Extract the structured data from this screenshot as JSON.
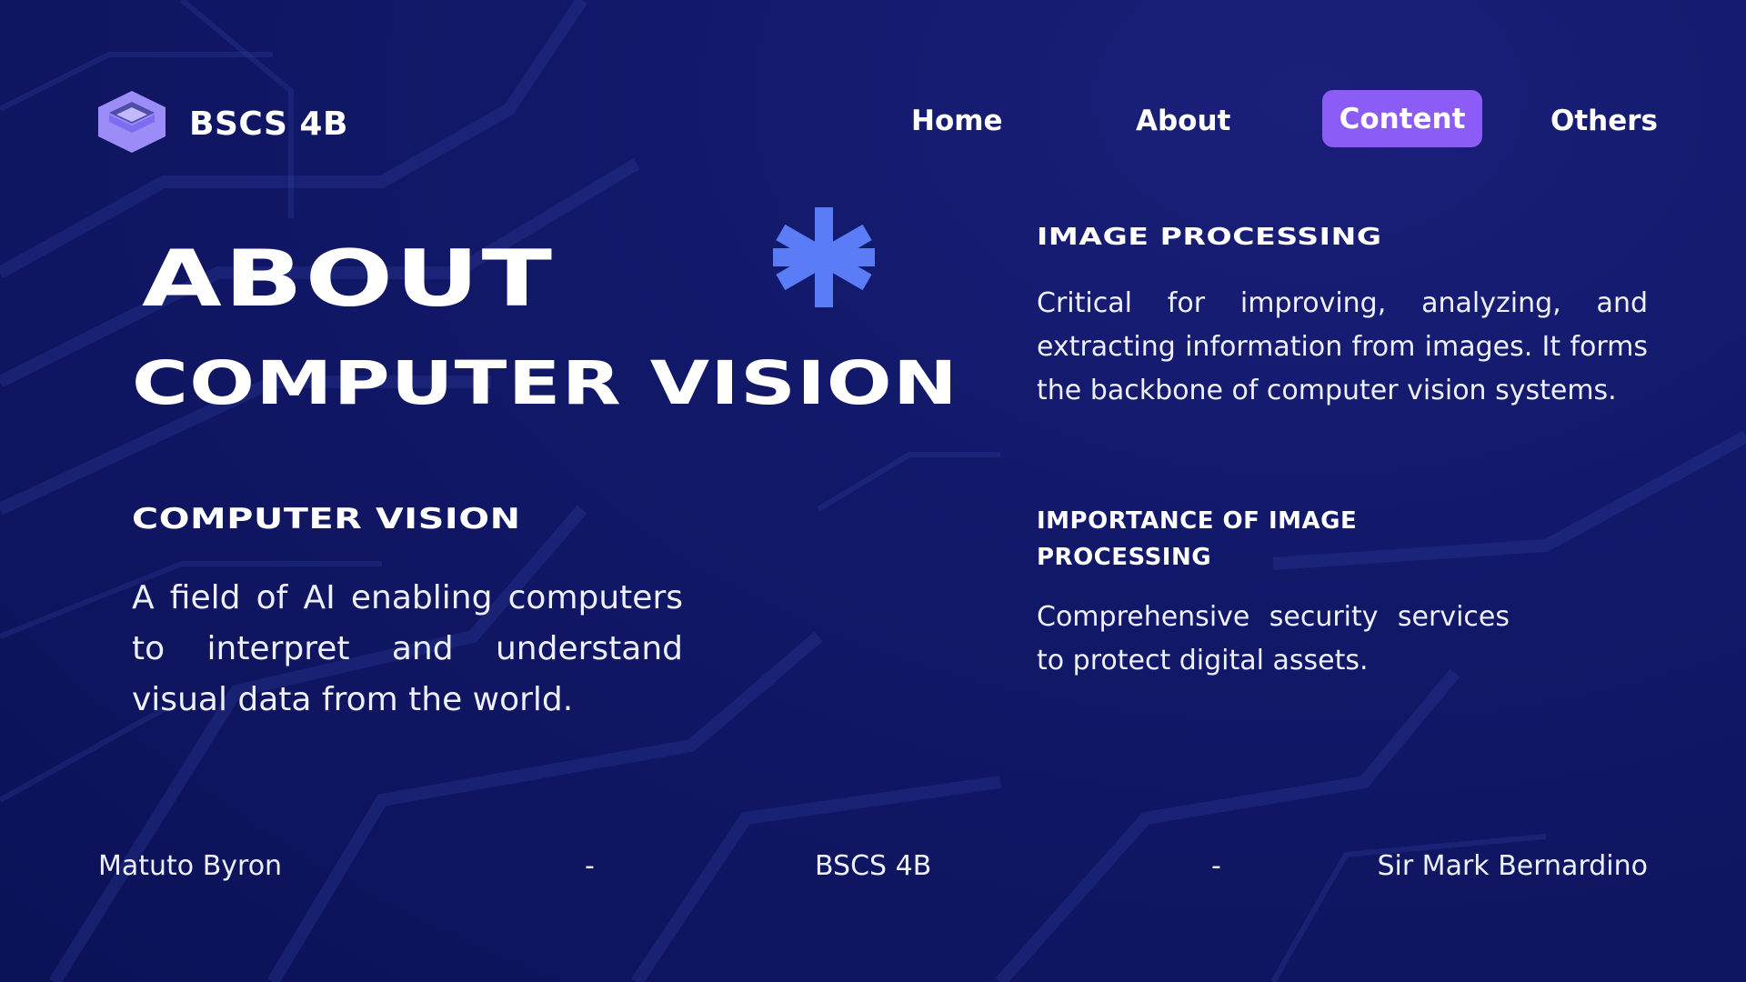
{
  "header": {
    "brand": "BSCS 4B",
    "nav": [
      {
        "label": "Home",
        "active": false
      },
      {
        "label": "About",
        "active": false
      },
      {
        "label": "Content",
        "active": true
      },
      {
        "label": "Others",
        "active": false
      }
    ],
    "active_color": "#8b5cf6"
  },
  "main": {
    "title_line1": "ABOUT",
    "title_line2": "COMPUTER VISION",
    "accent_icon": "asterisk-icon",
    "accent_color": "#5b7cf7",
    "sections": [
      {
        "heading": "COMPUTER VISION",
        "text": "A field of AI enabling computers to interpret and understand visual data from the world."
      },
      {
        "heading": "IMAGE PROCESSING",
        "text": "Critical for improving, analyzing, and extracting information from images. It forms the backbone of computer vision systems."
      },
      {
        "heading_line1": "IMPORTANCE OF IMAGE",
        "heading_line2": "PROCESSING",
        "text": "Comprehensive security services to protect digital assets."
      }
    ]
  },
  "footer": {
    "name": "Matuto Byron",
    "separator": "-",
    "class": "BSCS 4B",
    "teacher": "Sir Mark Bernardino"
  },
  "colors": {
    "background": "#12196a",
    "logo": "#9b8cf7"
  }
}
